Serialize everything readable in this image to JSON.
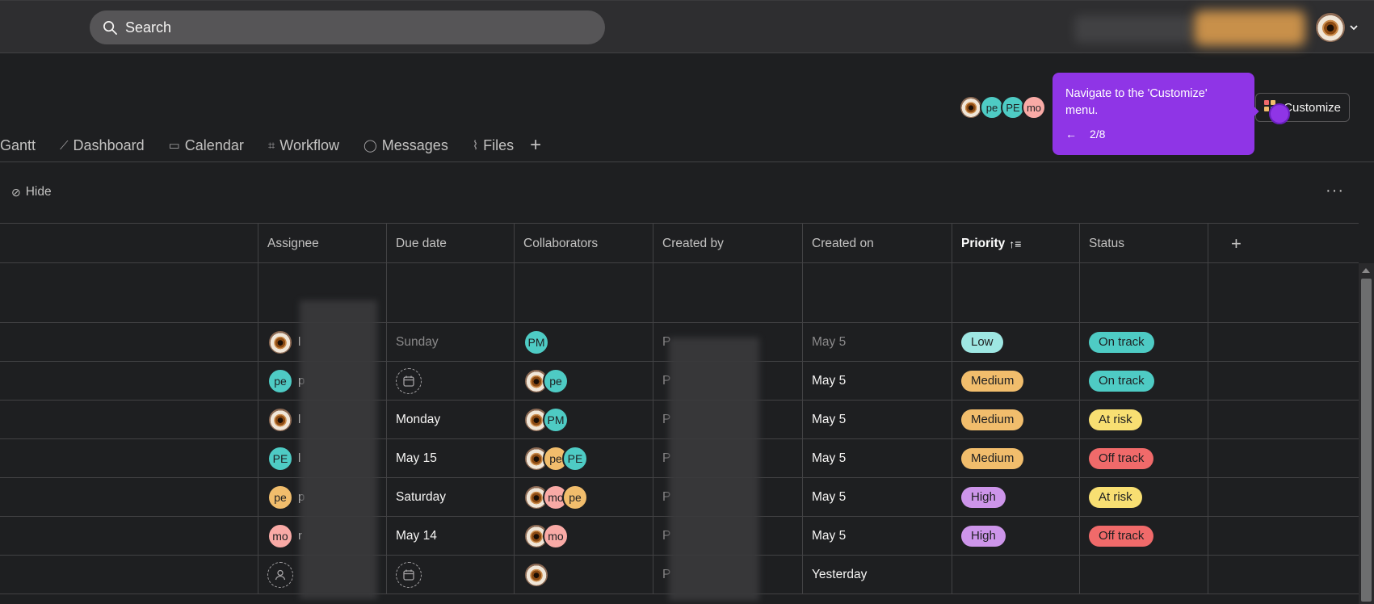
{
  "topbar": {
    "search_placeholder": "Search"
  },
  "header": {
    "facepile": [
      {
        "initials": "",
        "type": "photo"
      },
      {
        "initials": "pe",
        "color": "#4ecbc4"
      },
      {
        "initials": "PE",
        "color": "#4ecbc4"
      },
      {
        "initials": "mo",
        "color": "#f9aaa6"
      }
    ],
    "customize_label": "Customize"
  },
  "tooltip": {
    "message": "Navigate to the 'Customize' menu.",
    "back": "←",
    "step": "2/8"
  },
  "tabs": [
    {
      "label": "Gantt",
      "icon": ""
    },
    {
      "label": "Dashboard",
      "icon": "dashboard-icon"
    },
    {
      "label": "Calendar",
      "icon": "calendar-icon"
    },
    {
      "label": "Workflow",
      "icon": "workflow-icon"
    },
    {
      "label": "Messages",
      "icon": "message-icon"
    },
    {
      "label": "Files",
      "icon": "paperclip-icon"
    }
  ],
  "tab_add": "+",
  "toolbar": {
    "hide_label": "Hide",
    "more": "···"
  },
  "table": {
    "columns": [
      "Assignee",
      "Due date",
      "Collaborators",
      "Created by",
      "Created on",
      "Priority",
      "Status"
    ],
    "add_column": "+",
    "rows": [
      {
        "assignee": {
          "type": "photo",
          "initials": ""
        },
        "assignee_name": "l",
        "due": "Sunday",
        "due_dim": true,
        "collaborators": [
          {
            "initials": "PM",
            "color": "#4ecbc4"
          }
        ],
        "created_by": "P",
        "created_on": "May 5",
        "created_dim": true,
        "priority": "Low",
        "priority_color": "#9ee7e3",
        "status": "On track",
        "status_color": "#4ecbc4"
      },
      {
        "assignee": {
          "type": "initials",
          "initials": "pe",
          "color": "#4ecbc4"
        },
        "assignee_name": "p",
        "due": "",
        "due_empty": true,
        "collaborators": [
          {
            "type": "photo"
          },
          {
            "initials": "pe",
            "color": "#4ecbc4"
          }
        ],
        "created_by": "P",
        "created_on": "May 5",
        "priority": "Medium",
        "priority_color": "#f1bd6c",
        "status": "On track",
        "status_color": "#4ecbc4"
      },
      {
        "assignee": {
          "type": "photo"
        },
        "assignee_name": "l",
        "due": "Monday",
        "collaborators": [
          {
            "type": "photo"
          },
          {
            "initials": "PM",
            "color": "#4ecbc4"
          }
        ],
        "created_by": "P",
        "created_on": "May 5",
        "priority": "Medium",
        "priority_color": "#f1bd6c",
        "status": "At risk",
        "status_color": "#f8df72"
      },
      {
        "assignee": {
          "type": "initials",
          "initials": "PE",
          "color": "#4ecbc4"
        },
        "assignee_name": "l",
        "due": "May 15",
        "collaborators": [
          {
            "type": "photo"
          },
          {
            "initials": "pe",
            "color": "#f1bd6c"
          },
          {
            "initials": "PE",
            "color": "#4ecbc4"
          }
        ],
        "created_by": "P",
        "created_on": "May 5",
        "priority": "Medium",
        "priority_color": "#f1bd6c",
        "status": "Off track",
        "status_color": "#f06a6a"
      },
      {
        "assignee": {
          "type": "initials",
          "initials": "pe",
          "color": "#f1bd6c"
        },
        "assignee_name": "p",
        "due": "Saturday",
        "collaborators": [
          {
            "type": "photo"
          },
          {
            "initials": "mo",
            "color": "#f9aaa6"
          },
          {
            "initials": "pe",
            "color": "#f1bd6c"
          }
        ],
        "created_by": "P",
        "created_on": "May 5",
        "priority": "High",
        "priority_color": "#cd95ea",
        "status": "At risk",
        "status_color": "#f8df72"
      },
      {
        "assignee": {
          "type": "initials",
          "initials": "mo",
          "color": "#f9aaa6"
        },
        "assignee_name": "r",
        "due": "May 14",
        "collaborators": [
          {
            "type": "photo"
          },
          {
            "initials": "mo",
            "color": "#f9aaa6"
          }
        ],
        "created_by": "P",
        "created_on": "May 5",
        "priority": "High",
        "priority_color": "#cd95ea",
        "status": "Off track",
        "status_color": "#f06a6a"
      },
      {
        "assignee": {
          "type": "empty"
        },
        "assignee_name": "",
        "due": "",
        "due_empty": true,
        "collaborators": [
          {
            "type": "photo"
          }
        ],
        "created_by": "P",
        "created_on": "Yesterday",
        "priority": "",
        "status": ""
      }
    ]
  }
}
